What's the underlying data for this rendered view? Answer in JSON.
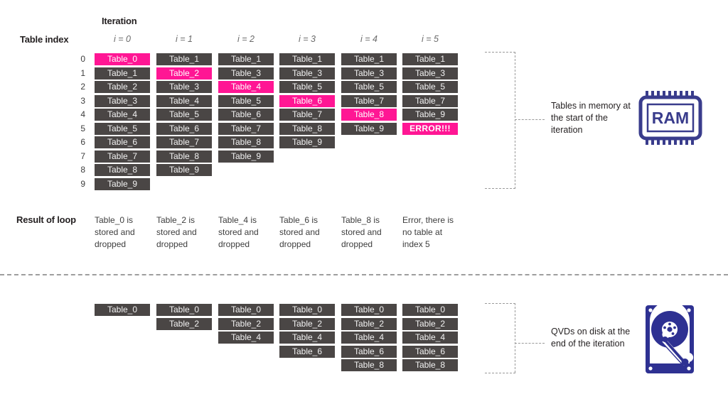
{
  "headers": {
    "iteration": "Iteration",
    "table_index": "Table index",
    "result_of_loop": "Result of loop"
  },
  "columns": [
    {
      "label": "i = 0"
    },
    {
      "label": "i = 1"
    },
    {
      "label": "i = 2"
    },
    {
      "label": "i = 3"
    },
    {
      "label": "i = 4"
    },
    {
      "label": "i = 5"
    }
  ],
  "row_indices": [
    "0",
    "1",
    "2",
    "3",
    "4",
    "5",
    "6",
    "7",
    "8",
    "9"
  ],
  "memory_columns": [
    {
      "cells": [
        {
          "text": "Table_0",
          "state": "highlight"
        },
        {
          "text": "Table_1",
          "state": "normal"
        },
        {
          "text": "Table_2",
          "state": "normal"
        },
        {
          "text": "Table_3",
          "state": "normal"
        },
        {
          "text": "Table_4",
          "state": "normal"
        },
        {
          "text": "Table_5",
          "state": "normal"
        },
        {
          "text": "Table_6",
          "state": "normal"
        },
        {
          "text": "Table_7",
          "state": "normal"
        },
        {
          "text": "Table_8",
          "state": "normal"
        },
        {
          "text": "Table_9",
          "state": "normal"
        }
      ]
    },
    {
      "cells": [
        {
          "text": "Table_1",
          "state": "normal"
        },
        {
          "text": "Table_2",
          "state": "highlight"
        },
        {
          "text": "Table_3",
          "state": "normal"
        },
        {
          "text": "Table_4",
          "state": "normal"
        },
        {
          "text": "Table_5",
          "state": "normal"
        },
        {
          "text": "Table_6",
          "state": "normal"
        },
        {
          "text": "Table_7",
          "state": "normal"
        },
        {
          "text": "Table_8",
          "state": "normal"
        },
        {
          "text": "Table_9",
          "state": "normal"
        }
      ]
    },
    {
      "cells": [
        {
          "text": "Table_1",
          "state": "normal"
        },
        {
          "text": "Table_3",
          "state": "normal"
        },
        {
          "text": "Table_4",
          "state": "highlight"
        },
        {
          "text": "Table_5",
          "state": "normal"
        },
        {
          "text": "Table_6",
          "state": "normal"
        },
        {
          "text": "Table_7",
          "state": "normal"
        },
        {
          "text": "Table_8",
          "state": "normal"
        },
        {
          "text": "Table_9",
          "state": "normal"
        }
      ]
    },
    {
      "cells": [
        {
          "text": "Table_1",
          "state": "normal"
        },
        {
          "text": "Table_3",
          "state": "normal"
        },
        {
          "text": "Table_5",
          "state": "normal"
        },
        {
          "text": "Table_6",
          "state": "highlight"
        },
        {
          "text": "Table_7",
          "state": "normal"
        },
        {
          "text": "Table_8",
          "state": "normal"
        },
        {
          "text": "Table_9",
          "state": "normal"
        }
      ]
    },
    {
      "cells": [
        {
          "text": "Table_1",
          "state": "normal"
        },
        {
          "text": "Table_3",
          "state": "normal"
        },
        {
          "text": "Table_5",
          "state": "normal"
        },
        {
          "text": "Table_7",
          "state": "normal"
        },
        {
          "text": "Table_8",
          "state": "highlight"
        },
        {
          "text": "Table_9",
          "state": "normal"
        }
      ]
    },
    {
      "cells": [
        {
          "text": "Table_1",
          "state": "normal"
        },
        {
          "text": "Table_3",
          "state": "normal"
        },
        {
          "text": "Table_5",
          "state": "normal"
        },
        {
          "text": "Table_7",
          "state": "normal"
        },
        {
          "text": "Table_9",
          "state": "normal"
        },
        {
          "text": "ERROR!!!",
          "state": "error"
        }
      ]
    }
  ],
  "results": [
    "Table_0 is stored and dropped",
    "Table_2 is stored and dropped",
    "Table_4 is stored and dropped",
    "Table_6 is stored and dropped",
    "Table_8 is stored and dropped",
    "Error, there is no table at index 5"
  ],
  "disk_columns": [
    {
      "cells": [
        "Table_0"
      ]
    },
    {
      "cells": [
        "Table_0",
        "Table_2"
      ]
    },
    {
      "cells": [
        "Table_0",
        "Table_2",
        "Table_4"
      ]
    },
    {
      "cells": [
        "Table_0",
        "Table_2",
        "Table_4",
        "Table_6"
      ]
    },
    {
      "cells": [
        "Table_0",
        "Table_2",
        "Table_4",
        "Table_6",
        "Table_8"
      ]
    },
    {
      "cells": [
        "Table_0",
        "Table_2",
        "Table_4",
        "Table_6",
        "Table_8"
      ]
    }
  ],
  "annotations": {
    "memory": "Tables in memory at the start of the iteration",
    "disk": "QVDs on disk at the end of the iteration"
  },
  "icons": {
    "ram_label": "RAM"
  },
  "colors": {
    "cell_background": "#4A4645",
    "highlight": "#FF1694",
    "icon": "#393C8C",
    "divider": "#9E9E9E",
    "text": "#3D3D3D"
  }
}
